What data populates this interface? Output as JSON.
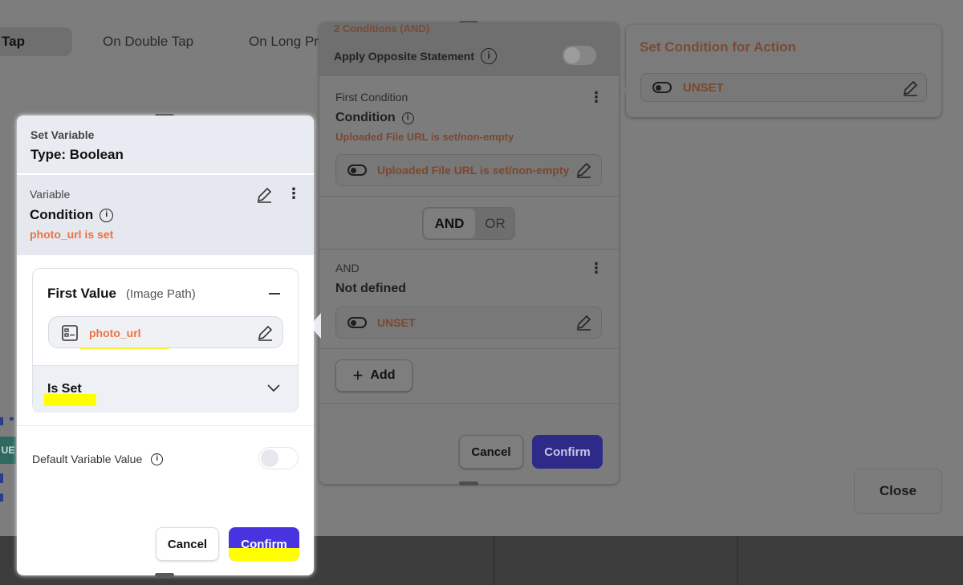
{
  "tabs": [
    {
      "label": "Tap",
      "active": true
    },
    {
      "label": "On Double Tap",
      "active": false
    },
    {
      "label": "On Long Press",
      "active": false
    }
  ],
  "background": {
    "left_badge": "UE",
    "close_label": "Close"
  },
  "set_condition": {
    "title": "Set Condition for Action",
    "value": "UNSET"
  },
  "conditions_panel": {
    "header_title": "2 Conditions (AND)",
    "apply_opposite_label": "Apply Opposite Statement",
    "first": {
      "caption": "First Condition",
      "title": "Condition",
      "summary": "Uploaded File URL is set/non-empty",
      "chip_text": "Uploaded File URL is set/non-empty"
    },
    "operators": {
      "and": "AND",
      "or": "OR"
    },
    "second": {
      "caption": "AND",
      "title": "Not defined",
      "chip_text": "UNSET"
    },
    "add_label": "Add",
    "cancel_label": "Cancel",
    "confirm_label": "Confirm"
  },
  "variable_dialog": {
    "caption": "Set Variable",
    "type_label": "Type: Boolean",
    "variable_caption": "Variable",
    "variable_title": "Condition",
    "variable_summary": "photo_url is set",
    "first_value_label": "First Value",
    "first_value_hint": "(Image Path)",
    "path_value": "photo_url",
    "operator_value": "Is Set",
    "default_value_label": "Default Variable Value",
    "cancel_label": "Cancel",
    "confirm_label": "Confirm"
  },
  "colors": {
    "accent": "#3d2fd0",
    "orange": "#f0713e",
    "highlight": "#ffff00"
  }
}
